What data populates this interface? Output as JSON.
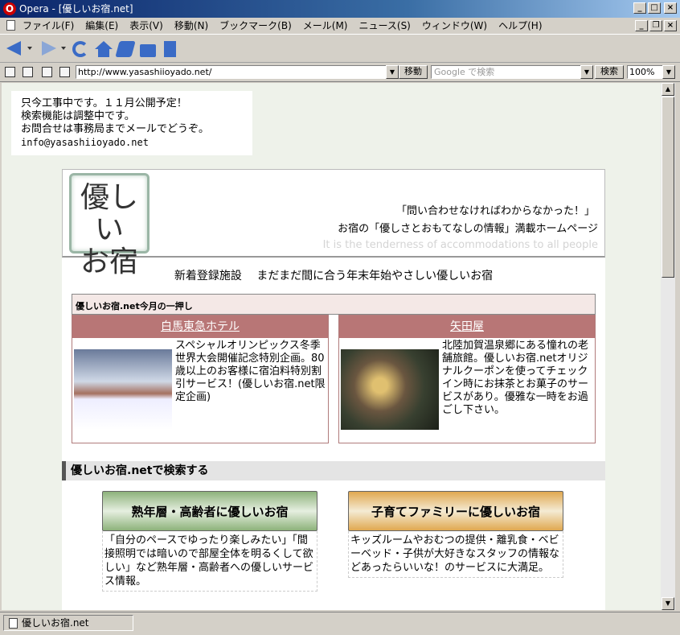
{
  "window": {
    "title": "Opera - [優しいお宿.net]"
  },
  "menu": [
    "ファイル(F)",
    "編集(E)",
    "表示(V)",
    "移動(N)",
    "ブックマーク(B)",
    "メール(M)",
    "ニュース(S)",
    "ウィンドウ(W)",
    "ヘルプ(H)"
  ],
  "address": {
    "url": "http://www.yasashiioyado.net/",
    "go_label": "移動",
    "search_placeholder": "Google で検索",
    "search_label": "検索",
    "zoom": "100%"
  },
  "notice": {
    "line1": "只今工事中です。１１月公開予定！",
    "line2": "検索機能は調整中です。",
    "line3": "お問合せは事務局までメールでどうぞ。",
    "email": "info@yasashiioyado.net"
  },
  "header": {
    "logo_line1": "優しい",
    "logo_line2": "お宿",
    "tagline1": "「問い合わせなければわからなかった！」",
    "tagline2": "お宿の「優しさとおもてなしの情報」満載ホームページ",
    "tagline3": "It is the tenderness of accommodations to all people"
  },
  "news_heading": "新着登録施設　 まだまだ間に合う年末年始やさしい優しいお宿",
  "pickup_label": "優しいお宿.net今月の一押し",
  "cards": [
    {
      "name": "白馬東急ホテル",
      "desc": "スペシャルオリンピックス冬季世界大会開催記念特別企画。80歳以上のお客様に宿泊料特別割引サービス！(優しいお宿.net限定企画)"
    },
    {
      "name": "矢田屋",
      "desc": "北陸加賀温泉郷にある憧れの老舗旅館。優しいお宿.netオリジナルクーポンを使ってチェックイン時にお抹茶とお菓子のサービスがあり。優雅な一時をお過ごし下さい。"
    }
  ],
  "search_section": {
    "heading": "優しいお宿.netで検索する",
    "categories": [
      {
        "label": "熟年層・高齢者に優しいお宿",
        "caption": "「自分のペースでゆったり楽しみたい」「間接照明では暗いので部屋全体を明るくして欲しい」など熟年層・高齢者への優しいサービス情報。",
        "color": "#8db27b"
      },
      {
        "label": "子育てファミリーに優しいお宿",
        "caption": "キッズルームやおむつの提供・離乳食・ベビーベッド・子供が大好きなスタッフの情報などあったらいいな！のサービスに大満足。",
        "color": "#e0a850"
      }
    ]
  },
  "status": {
    "tab_title": "優しいお宿.net"
  }
}
